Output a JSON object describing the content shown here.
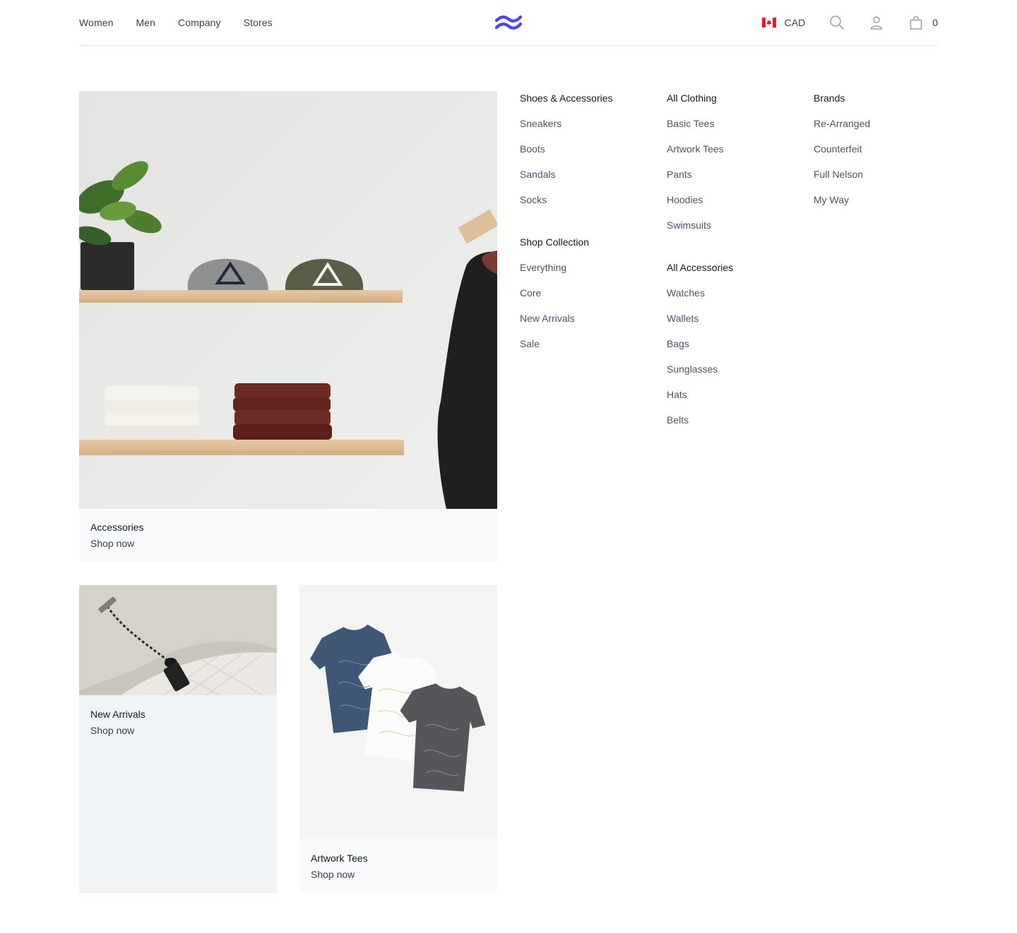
{
  "header": {
    "nav": [
      "Women",
      "Men",
      "Company",
      "Stores"
    ],
    "currency": "CAD",
    "cart_count": "0",
    "logo_color": "#4f46e5"
  },
  "features": {
    "accessories": {
      "title": "Accessories",
      "cta": "Shop now"
    },
    "new_arrivals": {
      "title": "New Arrivals",
      "cta": "Shop now"
    },
    "artwork_tees": {
      "title": "Artwork Tees",
      "cta": "Shop now"
    }
  },
  "menu": {
    "shoes": {
      "heading": "Shoes & Accessories",
      "items": [
        "Sneakers",
        "Boots",
        "Sandals",
        "Socks"
      ]
    },
    "collection": {
      "heading": "Shop Collection",
      "items": [
        "Everything",
        "Core",
        "New Arrivals",
        "Sale"
      ]
    },
    "clothing": {
      "heading": "All Clothing",
      "items": [
        "Basic Tees",
        "Artwork Tees",
        "Pants",
        "Hoodies",
        "Swimsuits"
      ]
    },
    "accessories": {
      "heading": "All Accessories",
      "items": [
        "Watches",
        "Wallets",
        "Bags",
        "Sunglasses",
        "Hats",
        "Belts"
      ]
    },
    "brands": {
      "heading": "Brands",
      "items": [
        "Re-Arranged",
        "Counterfeit",
        "Full Nelson",
        "My Way"
      ]
    }
  },
  "icons": {
    "flag": "canada-flag-icon",
    "search": "search-icon",
    "user": "user-icon",
    "cart": "shopping-bag-icon",
    "logo": "brand-logo-icon"
  }
}
